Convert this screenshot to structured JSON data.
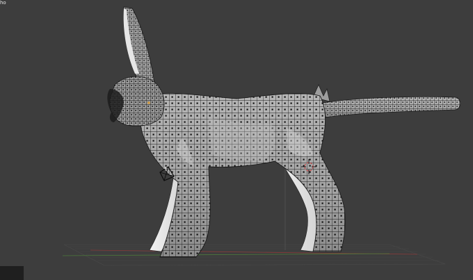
{
  "viewport": {
    "label": "ho",
    "background": "#3d3d3d"
  },
  "scene": {
    "object": "creature-mesh",
    "mesh_fill": "#a9a9a9",
    "wire_color": "#1a1a1a",
    "vertex_color": "#111111",
    "grid_color": "#4a4a4a",
    "x_axis_color": "#8a3a3a",
    "y_axis_color": "#4c7a3a",
    "cursor_color": "#c84a4a",
    "icons": [
      "3d-cursor-icon",
      "camera-icon",
      "light-icon"
    ]
  }
}
